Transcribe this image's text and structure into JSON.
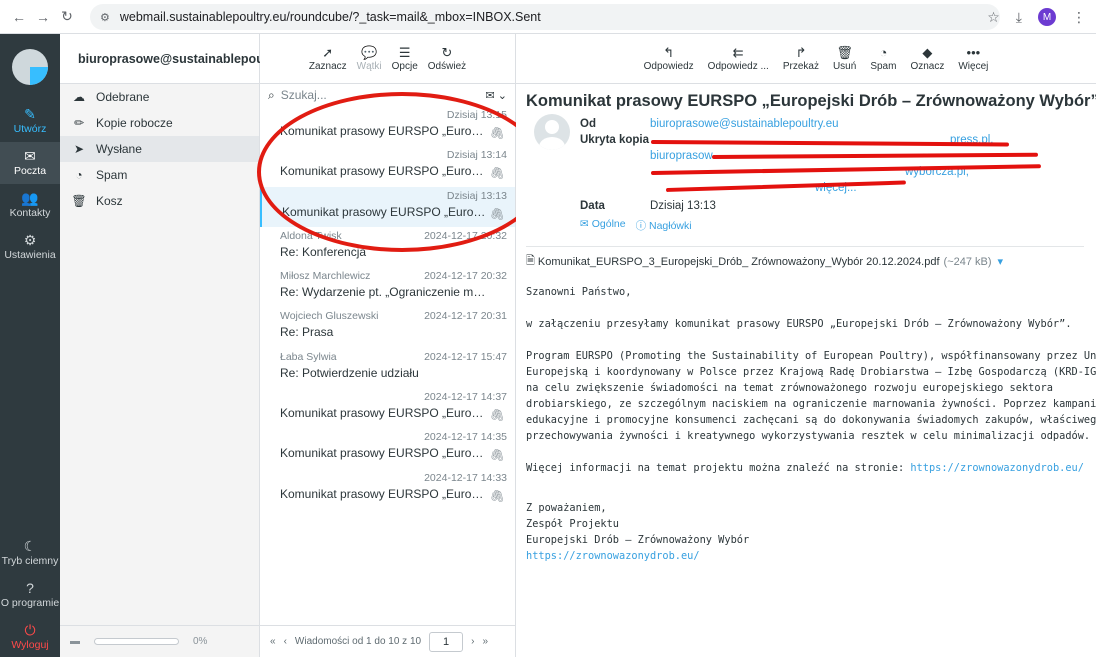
{
  "browser": {
    "url": "webmail.sustainablepoultry.eu/roundcube/?_task=mail&_mbox=INBOX.Sent",
    "profile_initial": "M"
  },
  "rail": {
    "items": [
      {
        "label": "Utwórz",
        "icon": "compose-icon"
      },
      {
        "label": "Poczta",
        "icon": "mail-icon"
      },
      {
        "label": "Kontakty",
        "icon": "contacts-icon"
      },
      {
        "label": "Ustawienia",
        "icon": "gear-icon"
      }
    ],
    "bottom": [
      {
        "label": "Tryb ciemny",
        "icon": "moon-icon"
      },
      {
        "label": "O programie",
        "icon": "question-icon"
      },
      {
        "label": "Wyloguj",
        "icon": "power-icon"
      }
    ]
  },
  "folders": {
    "account": "biuroprasowe@sustainablepoultr...",
    "items": [
      {
        "label": "Odebrane",
        "icon": "inbox-icon"
      },
      {
        "label": "Kopie robocze",
        "icon": "pencil-icon"
      },
      {
        "label": "Wysłane",
        "icon": "send-icon"
      },
      {
        "label": "Spam",
        "icon": "spam-icon"
      },
      {
        "label": "Kosz",
        "icon": "trash-icon"
      }
    ],
    "quota": "0%"
  },
  "list_toolbar": {
    "buttons": [
      {
        "label": "Zaznacz",
        "icon": "cursor-icon"
      },
      {
        "label": "Wątki",
        "icon": "threads-icon"
      },
      {
        "label": "Opcje",
        "icon": "options-icon"
      },
      {
        "label": "Odśwież",
        "icon": "refresh-icon"
      }
    ]
  },
  "search": {
    "placeholder": "Szukaj..."
  },
  "messages": [
    {
      "from": "",
      "date": "Dzisiaj 13:15",
      "subject": "Komunikat prasowy EURSPO „Europejski D...",
      "attachment": true
    },
    {
      "from": "",
      "date": "Dzisiaj 13:14",
      "subject": "Komunikat prasowy EURSPO „Europejski D...",
      "attachment": true
    },
    {
      "from": "",
      "date": "Dzisiaj 13:13",
      "subject": "Komunikat prasowy EURSPO „Europejski D...",
      "attachment": true
    },
    {
      "from": "Aldona Twisk",
      "date": "2024-12-17 20:32",
      "subject": "Re: Konferencja",
      "attachment": false
    },
    {
      "from": "Miłosz Marchlewicz",
      "date": "2024-12-17 20:32",
      "subject": "Re: Wydarzenie pt. „Ograniczenie marnowa...",
      "attachment": false
    },
    {
      "from": "Wojciech Gluszewski",
      "date": "2024-12-17 20:31",
      "subject": "Re: Prasa",
      "attachment": false
    },
    {
      "from": "Łaba Sylwia",
      "date": "2024-12-17 15:47",
      "subject": "Re: Potwierdzenie udziału",
      "attachment": false
    },
    {
      "from": "",
      "date": "2024-12-17 14:37",
      "subject": "Komunikat prasowy EURSPO „Europejski D...",
      "attachment": true
    },
    {
      "from": "",
      "date": "2024-12-17 14:35",
      "subject": "Komunikat prasowy EURSPO „Europejski D...",
      "attachment": true
    },
    {
      "from": "",
      "date": "2024-12-17 14:33",
      "subject": "Komunikat prasowy EURSPO „Europejski D...",
      "attachment": true
    }
  ],
  "list_footer": {
    "count_text": "Wiadomości od 1 do 10 z 10",
    "page": "1"
  },
  "mail_toolbar": {
    "buttons": [
      {
        "label": "Odpowiedz",
        "icon": "reply-icon"
      },
      {
        "label": "Odpowiedz ...",
        "icon": "reply-all-icon"
      },
      {
        "label": "Przekaż",
        "icon": "forward-icon"
      },
      {
        "label": "Usuń",
        "icon": "trash-icon"
      },
      {
        "label": "Spam",
        "icon": "spam-icon"
      },
      {
        "label": "Oznacz",
        "icon": "tag-icon"
      },
      {
        "label": "Więcej",
        "icon": "more-icon"
      }
    ]
  },
  "mail": {
    "subject": "Komunikat prasowy EURSPO „Europejski Drób – Zrównoważony Wybór”",
    "from_label": "Od",
    "from": "biuroprasowe@sustainablepoultry.eu",
    "bcc_label": "Ukryta kopia",
    "bcc_lines": [
      "press.pl,",
      "biuroprasow",
      "",
      "wyborcza.pl,",
      "więcej..."
    ],
    "date_label": "Data",
    "date": "Dzisiaj 13:13",
    "header_links": [
      "Ogólne",
      "Nagłówki"
    ],
    "attachment_name": "Komunikat_EURSPO_3_Europejski_Drób_ Zrównoważony_Wybór 20.12.2024.pdf",
    "attachment_size": "(~247 kB)",
    "body": {
      "greeting": "Szanowni Państwo,",
      "p1": "w załączeniu przesyłamy komunikat prasowy EURSPO „Europejski Drób – Zrównoważony Wybór”.",
      "p2_lines": [
        "Program EURSPO (Promoting the Sustainability of European Poultry), współfinansowany przez Unię",
        "Europejską i koordynowany w Polsce przez Krajową Radę Drobiarstwa – Izbę Gospodarczą (KRD-IG) ma",
        "na celu zwiększenie świadomości na temat zrównoważonego rozwoju europejskiego sektora",
        "drobiarskiego, ze szczególnym naciskiem na ograniczenie marnowania żywności. Poprzez kampanie",
        "edukacyjne i promocyjne konsumenci zachęcani są do dokonywania świadomych zakupów, właściwego",
        "przechowywania żywności i kreatywnego wykorzystywania resztek w celu minimalizacji odpadów."
      ],
      "p3": "Więcej informacji na temat projektu można znaleźć na stronie: ",
      "p3_link": "https://zrownowazonydrob.eu/",
      "sig": [
        "Z poważaniem,",
        "Zespół Projektu",
        "Europejski Drób – Zrównoważony Wybór"
      ],
      "sig_link": "https://zrownowazonydrob.eu/"
    }
  },
  "colors": {
    "accent": "#37beff",
    "annotation": "#e11c12",
    "rail_bg": "#2f3a3f"
  }
}
